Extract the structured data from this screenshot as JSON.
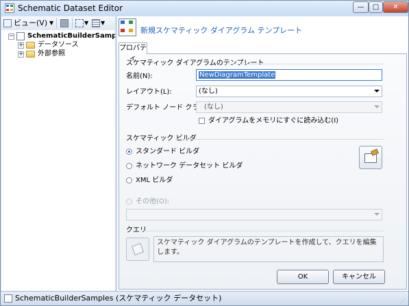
{
  "window": {
    "title": "Schematic Dataset Editor",
    "controls": {
      "minimize": "—",
      "maximize": "□",
      "close": "✕"
    }
  },
  "toolbar": {
    "view_label": "ビュー(V)",
    "icons": [
      "save-icon",
      "grid-layout-icon",
      "list-layout-icon"
    ]
  },
  "tree": {
    "root": {
      "label": "SchematicBuilderSamples",
      "expander": "−"
    },
    "items": [
      {
        "label": "データソース",
        "expander": "+"
      },
      {
        "label": "外部参照",
        "expander": "+"
      }
    ]
  },
  "header": {
    "link": "新規スケマティック ダイアグラム テンプレート"
  },
  "tabs": [
    {
      "label": "プロパティ"
    }
  ],
  "template_group": {
    "title": "スケマティック ダイアグラムのテンプレート",
    "name_label": "名前(N):",
    "name_value": "NewDiagramTemplate",
    "layout_label": "レイアウト(L):",
    "layout_value": "(なし)",
    "node_class_label": "デフォルト ノード クラス(N):",
    "node_class_value": "(なし)",
    "load_in_memory_label": "ダイアグラムをメモリにすぐに読み込む(I)",
    "load_in_memory_checked": false
  },
  "builder_group": {
    "title": "スケマティック ビルダ",
    "options": [
      {
        "label": "スタンダード ビルダ",
        "selected": true
      },
      {
        "label": "ネットワーク データセット ビルダ",
        "selected": false
      },
      {
        "label": "XML ビルダ",
        "selected": false
      }
    ],
    "other_label": "その他(O):",
    "other_value": ""
  },
  "query_group": {
    "title": "クエリ",
    "message": "スケマティック ダイアグラムのテンプレートを作成して、クエリを編集します。"
  },
  "buttons": {
    "ok": "OK",
    "cancel": "キャンセル"
  },
  "status": {
    "text": "SchematicBuilderSamples (スケマティック データセット)"
  },
  "colors": {
    "link": "#1b63c4",
    "selection": "#3d7bd0",
    "frame": "#d6e4f3"
  }
}
